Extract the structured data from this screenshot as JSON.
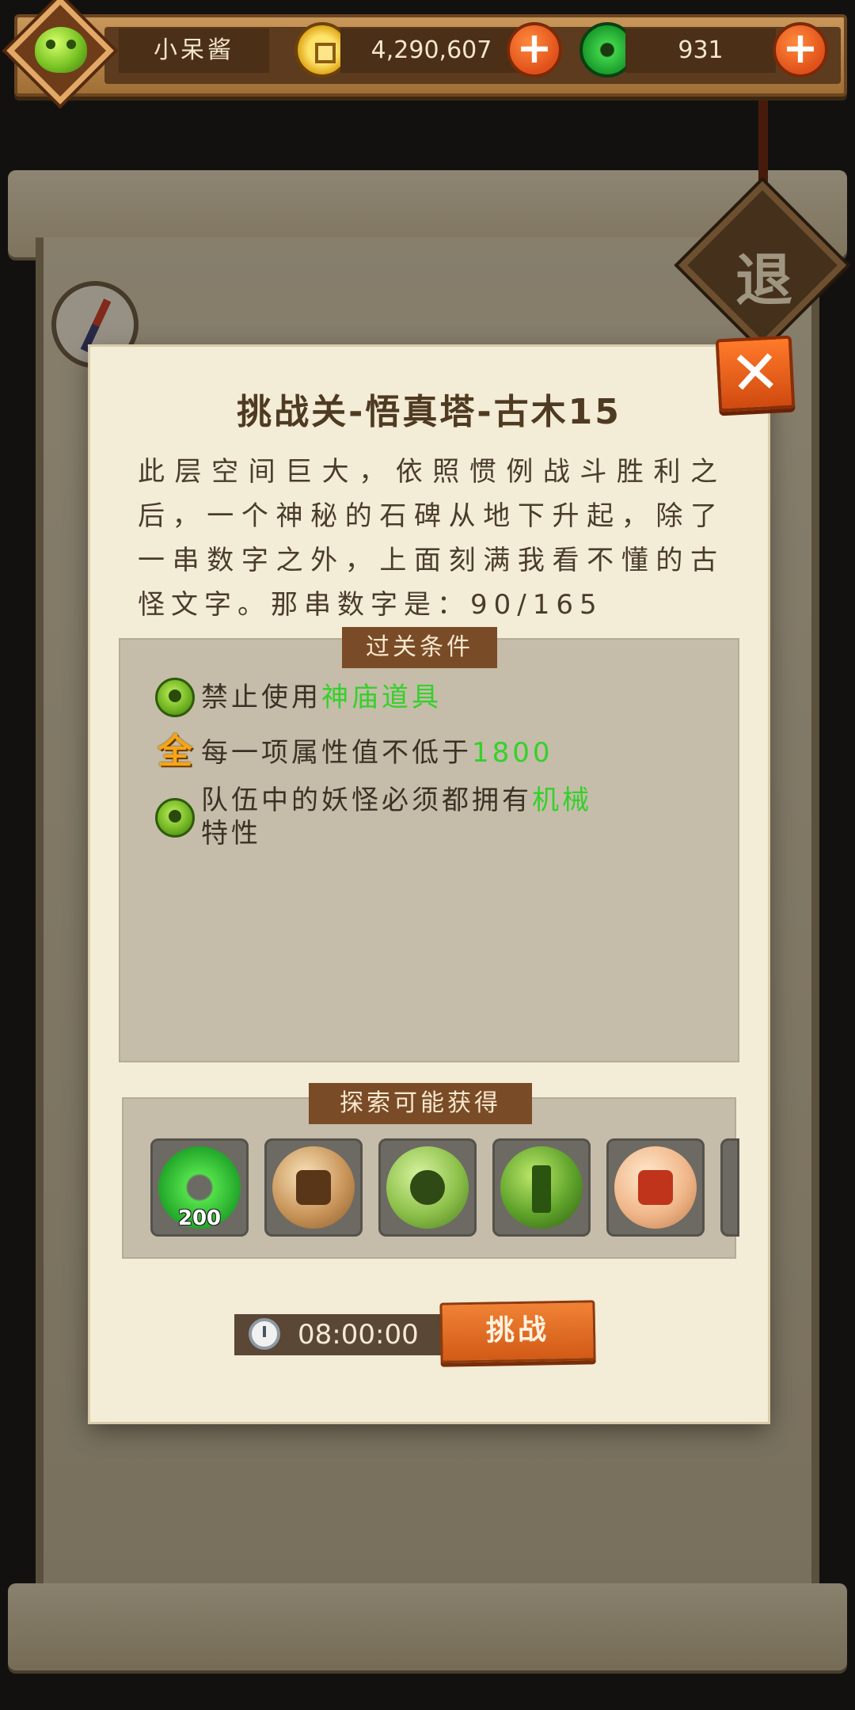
{
  "hud": {
    "player_name": "小呆酱",
    "coins": "4,290,607",
    "jade": "931",
    "plus_label": "+"
  },
  "background": {
    "exit_label": "退"
  },
  "dialog": {
    "close_label": "✕",
    "title": "挑战关-悟真塔-古木15",
    "description": "此层空间巨大，依照惯例战斗胜利之后，一个神秘的石碑从地下升起，除了一串数字之外，上面刻满我看不懂的古怪文字。那串数字是：90/165",
    "conditions_tab": "过关条件",
    "conditions": [
      {
        "icon": "green-orb-icon",
        "text": "禁止使用",
        "highlight": "神庙道具",
        "suffix": ""
      },
      {
        "icon": "all-attributes-icon",
        "icon_glyph": "全",
        "text": "每一项属性值不低于",
        "highlight": "1800",
        "suffix": ""
      },
      {
        "icon": "green-orb-icon",
        "text": "队伍中的妖怪必须都拥有",
        "highlight": "机械",
        "suffix": "特性"
      }
    ],
    "rewards_tab": "探索可能获得",
    "rewards": [
      {
        "icon": "jade-reward-icon",
        "count": "200"
      },
      {
        "icon": "brown-rune-orb-icon",
        "count": ""
      },
      {
        "icon": "green-mech-orb-icon",
        "count": ""
      },
      {
        "icon": "tree-orb-icon",
        "count": ""
      },
      {
        "icon": "red-strength-orb-icon",
        "count": ""
      }
    ],
    "timer": "08:00:00",
    "challenge_label": "挑战"
  },
  "colors": {
    "highlight_green": "#34d12a",
    "button_orange": "#e0501a",
    "panel_bg": "#c5bda9",
    "dialog_bg": "#f3ecd7"
  }
}
